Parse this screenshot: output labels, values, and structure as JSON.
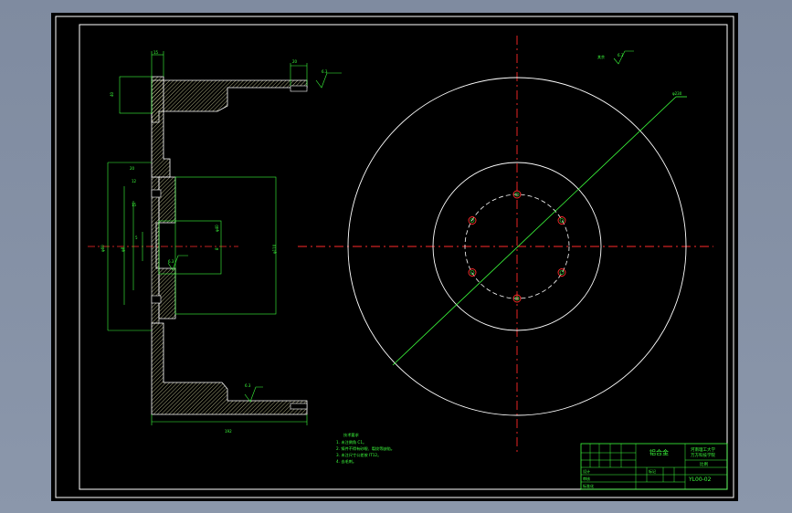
{
  "colors": {
    "background": "#7f8ba0",
    "paper": "#000000",
    "frame": "#ffffff",
    "outline": "#3cff3c",
    "centerline": "#ff2a2a",
    "hatch": "#d8d8a0",
    "circle": "#ffffff"
  },
  "drawing": {
    "section_view": {
      "dims": {
        "top_width": "15",
        "top_height": "40",
        "bolt_top": "20",
        "flange_step": "20",
        "hole_a": "12",
        "hole_b": "15",
        "bore_depth": "5",
        "bore_dia": "8",
        "inner_dia": "φ60",
        "outer_dia": "φ8",
        "hub_dia": "φ110",
        "hub_small": "φ40",
        "bottom_length": "192",
        "roughness_a": "6.3",
        "roughness_b": "6.3",
        "roughness_c": "6.3"
      }
    },
    "circle_view": {
      "dia_label": "φ230",
      "roughness_label": "其余",
      "roughness_value": "6.3"
    },
    "tech_notes": {
      "title": "技术要求",
      "lines": [
        "1. 未注倒角 C1。",
        "2. 铸件不得有砂眼、裂纹等缺陷。",
        "3. 未注尺寸公差按 IT12。",
        "4. 去毛刺。"
      ]
    },
    "title_block": {
      "material": "铝合金",
      "school_line1": "河南理工大学",
      "school_line2": "万方科技学院",
      "scale_label": "比例",
      "drawing_no": "YL00-02",
      "designer": "设计",
      "checker": "审核",
      "standard": "标准化",
      "mark": "标记"
    }
  }
}
